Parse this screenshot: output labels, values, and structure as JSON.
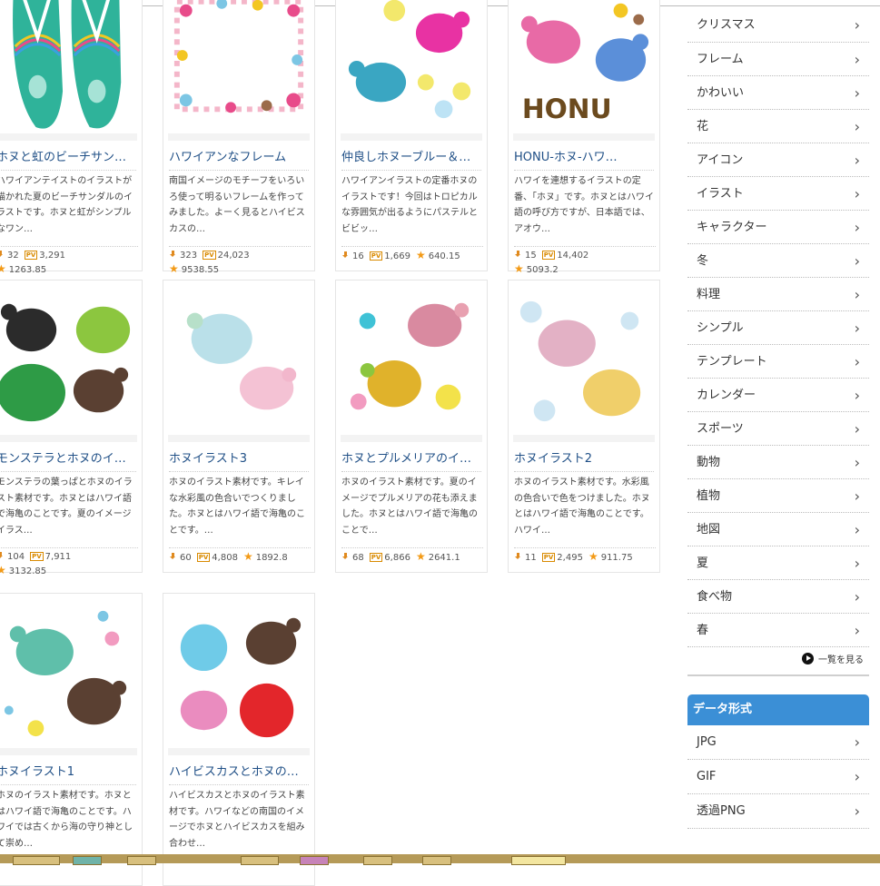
{
  "cards": [
    {
      "title": "ホヌと虹のビーチサン…",
      "desc": "ハワイアンテイストのイラストが描かれた夏のビーチサンダルのイラストです。ホヌと虹がシンプルなワン…",
      "downloads": "32",
      "pv": "3,291",
      "rating": "1263.85"
    },
    {
      "title": "ハワイアンなフレーム",
      "desc": "南国イメージのモチーフをいろいろ使って明るいフレームを作ってみました。よーく見るとハイビスカスの…",
      "downloads": "323",
      "pv": "24,023",
      "rating": "9538.55"
    },
    {
      "title": "仲良しホヌーブルー＆…",
      "desc": "ハワイアンイラストの定番ホヌのイラストです！今回はトロピカルな雰囲気が出るようにパステルとビビッ…",
      "downloads": "16",
      "pv": "1,669",
      "rating": "640.15"
    },
    {
      "title": "HONU-ホヌ-ハワ…",
      "desc": "ハワイを連想するイラストの定番、「ホヌ」です。ホヌとはハワイ語の呼び方ですが、日本語では、アオウ…",
      "downloads": "15",
      "pv": "14,402",
      "rating": "5093.2"
    },
    {
      "title": "モンステラとホヌのイ…",
      "desc": "モンステラの葉っぱとホヌのイラスト素材です。ホヌとはハワイ語で海亀のことです。夏のイメージイラス…",
      "downloads": "104",
      "pv": "7,911",
      "rating": "3132.85"
    },
    {
      "title": "ホヌイラスト3",
      "desc": "ホヌのイラスト素材です。キレイな水彩風の色合いでつくりました。ホヌとはハワイ語で海亀のことです。…",
      "downloads": "60",
      "pv": "4,808",
      "rating": "1892.8"
    },
    {
      "title": "ホヌとプルメリアのイ…",
      "desc": "ホヌのイラスト素材です。夏のイメージでプルメリアの花も添えました。ホヌとはハワイ語で海亀のことで…",
      "downloads": "68",
      "pv": "6,866",
      "rating": "2641.1"
    },
    {
      "title": "ホヌイラスト2",
      "desc": "ホヌのイラスト素材です。水彩風の色合いで色をつけました。ホヌとはハワイ語で海亀のことです。ハワイ…",
      "downloads": "11",
      "pv": "2,495",
      "rating": "911.75"
    },
    {
      "title": "ホヌイラスト1",
      "desc": "ホヌのイラスト素材です。ホヌとはハワイ語で海亀のことです。ハワイでは古くから海の守り神として崇め…",
      "downloads": "",
      "pv": "",
      "rating": ""
    },
    {
      "title": "ハイビスカスとホヌの…",
      "desc": "ハイビスカスとホヌのイラスト素材です。ハワイなどの南国のイメージでホヌとハイビスカスを組み合わせ…",
      "downloads": "",
      "pv": "",
      "rating": ""
    }
  ],
  "thumb_texts": {
    "honu": "HONU"
  },
  "stat_icons": {
    "pv": "PV"
  },
  "sidebar": {
    "categories": [
      "クリスマス",
      "フレーム",
      "かわいい",
      "花",
      "アイコン",
      "イラスト",
      "キャラクター",
      "冬",
      "料理",
      "シンプル",
      "テンプレート",
      "カレンダー",
      "スポーツ",
      "動物",
      "植物",
      "地図",
      "夏",
      "食べ物",
      "春"
    ],
    "see_all": "一覧を見る",
    "format_heading": "データ形式",
    "formats": [
      "JPG",
      "GIF",
      "透過PNG"
    ]
  },
  "colors": {
    "title": "#1f4f86",
    "accent": "#3b8fd6",
    "star": "#f39a16",
    "download": "#e08a1e"
  }
}
